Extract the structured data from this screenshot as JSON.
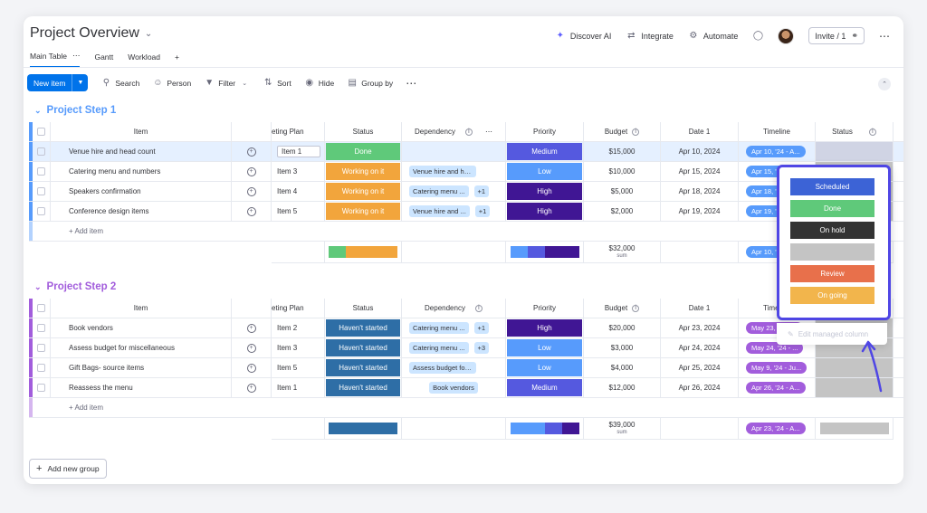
{
  "header": {
    "title": "Project Overview",
    "actions": [
      "Discover AI",
      "Integrate",
      "Automate"
    ],
    "invite_label": "Invite / 1"
  },
  "tabs": [
    {
      "label": "Main Table",
      "active": true
    },
    {
      "label": "Gantt"
    },
    {
      "label": "Workload"
    },
    {
      "label": "+"
    }
  ],
  "toolbar": {
    "new_item": "New item",
    "tools": [
      "Search",
      "Person",
      "Filter",
      "Sort",
      "Hide",
      "Group by"
    ]
  },
  "columns": {
    "item": "Item",
    "plan": "eting Plan",
    "status": "Status",
    "dependency": "Dependency",
    "priority": "Priority",
    "budget": "Budget",
    "date": "Date 1",
    "timeline": "Timeline",
    "status2": "Status"
  },
  "colors": {
    "done": "#5fc97a",
    "working": "#f2a53c",
    "not_started": "#2e6ea6",
    "low": "#579bfc",
    "medium": "#5559df",
    "high": "#401694",
    "scheduled": "#3c63d6",
    "on_hold": "#333333",
    "blank": "#c4c4c4",
    "review": "#e8704b",
    "on_going": "#f2b54c",
    "group1": "#579bfc",
    "group2": "#a25ddc"
  },
  "groups": [
    {
      "title": "Project Step 1",
      "color": "#579bfc",
      "rows": [
        {
          "item": "Venue hire and head count",
          "plan": "Item 1",
          "status": "Done",
          "status_color": "#5fc97a",
          "dep": "",
          "dep_more": "",
          "priority": "Medium",
          "pri_color": "#5559df",
          "budget": "$15,000",
          "date": "Apr 10, 2024",
          "timeline": "Apr 10, '24 - A...",
          "tl_color": "#579bfc",
          "selected": true
        },
        {
          "item": "Catering menu and numbers",
          "plan": "Item 3",
          "status": "Working on it",
          "status_color": "#f2a53c",
          "dep": "Venue hire and head ...",
          "dep_more": "",
          "priority": "Low",
          "pri_color": "#579bfc",
          "budget": "$10,000",
          "date": "Apr 15, 2024",
          "timeline": "Apr 15, '24 - A...",
          "tl_color": "#579bfc"
        },
        {
          "item": "Speakers confirmation",
          "plan": "Item 4",
          "status": "Working on it",
          "status_color": "#f2a53c",
          "dep": "Catering menu ...",
          "dep_more": "+1",
          "priority": "High",
          "pri_color": "#401694",
          "budget": "$5,000",
          "date": "Apr 18, 2024",
          "timeline": "Apr 18, '24 - A...",
          "tl_color": "#579bfc"
        },
        {
          "item": "Conference design items",
          "plan": "Item 5",
          "status": "Working on it",
          "status_color": "#f2a53c",
          "dep": "Venue hire and ...",
          "dep_more": "+1",
          "priority": "High",
          "pri_color": "#401694",
          "budget": "$2,000",
          "date": "Apr 19, 2024",
          "timeline": "Apr 19, '24 - A...",
          "tl_color": "#579bfc"
        }
      ],
      "add_item": "+ Add item",
      "summary": {
        "status_segments": [
          {
            "color": "#5fc97a",
            "share": 0.25
          },
          {
            "color": "#f2a53c",
            "share": 0.75
          }
        ],
        "priority_segments": [
          {
            "color": "#579bfc",
            "share": 0.25
          },
          {
            "color": "#5559df",
            "share": 0.25
          },
          {
            "color": "#401694",
            "share": 0.5
          }
        ],
        "budget": "$32,000",
        "budget_label": "sum",
        "timeline": "Apr 10, '24 - A..."
      }
    },
    {
      "title": "Project Step 2",
      "color": "#a25ddc",
      "rows": [
        {
          "item": "Book vendors",
          "plan": "Item 2",
          "status": "Haven't started",
          "status_color": "#2e6ea6",
          "dep": "Catering menu ...",
          "dep_more": "+1",
          "priority": "High",
          "pri_color": "#401694",
          "budget": "$20,000",
          "date": "Apr 23, 2024",
          "timeline": "May 23, '24 - ...",
          "tl_color": "#a25ddc"
        },
        {
          "item": "Assess budget for miscellaneous",
          "plan": "Item 3",
          "status": "Haven't started",
          "status_color": "#2e6ea6",
          "dep": "Catering menu ...",
          "dep_more": "+3",
          "priority": "Low",
          "pri_color": "#579bfc",
          "budget": "$3,000",
          "date": "Apr 24, 2024",
          "timeline": "May 24, '24 - ...",
          "tl_color": "#a25ddc"
        },
        {
          "item": "Gift Bags- source items",
          "plan": "Item 5",
          "status": "Haven't started",
          "status_color": "#2e6ea6",
          "dep": "Assess budget for mi...",
          "dep_more": "",
          "priority": "Low",
          "pri_color": "#579bfc",
          "budget": "$4,000",
          "date": "Apr 25, 2024",
          "timeline": "May 9, '24 - Ju...",
          "tl_color": "#a25ddc"
        },
        {
          "item": "Reassess the menu",
          "plan": "Item 1",
          "status": "Haven't started",
          "status_color": "#2e6ea6",
          "dep": "Book vendors",
          "dep_more": "",
          "priority": "Medium",
          "pri_color": "#5559df",
          "budget": "$12,000",
          "date": "Apr 26, 2024",
          "timeline": "Apr 26, '24 - A...",
          "tl_color": "#a25ddc"
        }
      ],
      "add_item": "+ Add item",
      "summary": {
        "status_segments": [
          {
            "color": "#2e6ea6",
            "share": 1
          }
        ],
        "priority_segments": [
          {
            "color": "#579bfc",
            "share": 0.5
          },
          {
            "color": "#5559df",
            "share": 0.25
          },
          {
            "color": "#401694",
            "share": 0.25
          }
        ],
        "budget": "$39,000",
        "budget_label": "sum",
        "timeline": "Apr 23, '24 - A..."
      }
    }
  ],
  "add_group": "Add new group",
  "status_menu": {
    "options": [
      {
        "label": "Scheduled",
        "color": "#3c63d6"
      },
      {
        "label": "Done",
        "color": "#5fc97a"
      },
      {
        "label": "On hold",
        "color": "#333333"
      },
      {
        "label": "",
        "color": "#c4c4c4"
      },
      {
        "label": "Review",
        "color": "#e8704b"
      },
      {
        "label": "On going",
        "color": "#f2b54c"
      }
    ],
    "edit_label": "Edit managed column"
  }
}
